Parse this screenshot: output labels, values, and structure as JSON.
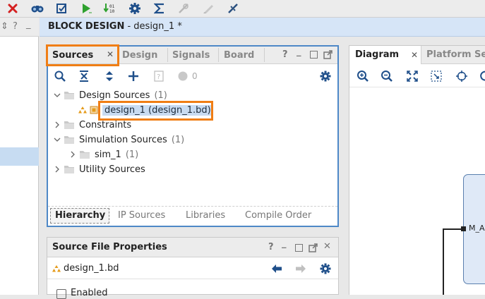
{
  "toolbar": {
    "buttons": [
      "close-icon",
      "binoculars-icon",
      "checkbox-icon",
      "run-icon",
      "run-step-icon",
      "gear-icon",
      "sigma-icon",
      "disabled-tool-icon",
      "disabled-edit-icon",
      "disconnect-icon"
    ]
  },
  "left_strip": {
    "glyphs": "⇕ ? _"
  },
  "block_design": {
    "title_bold": "BLOCK DESIGN",
    "title_rest": " - design_1 *"
  },
  "sources_panel": {
    "tabs": [
      "Sources",
      "Design",
      "Signals",
      "Board"
    ],
    "active_tab": "Sources",
    "close_glyph": "✕",
    "toolbar_count": "0",
    "tree": {
      "design_sources": {
        "label": "Design Sources",
        "count": "(1)"
      },
      "design_file": {
        "label": "design_1 (design_1.bd)"
      },
      "constraints": {
        "label": "Constraints"
      },
      "simulation_sources": {
        "label": "Simulation Sources",
        "count": "(1)"
      },
      "sim_1": {
        "label": "sim_1",
        "count": "(1)"
      },
      "utility_sources": {
        "label": "Utility Sources"
      }
    },
    "bottom_tabs": [
      "Hierarchy",
      "IP Sources",
      "Libraries",
      "Compile Order"
    ],
    "active_bottom_tab": "Hierarchy"
  },
  "source_file_properties": {
    "title": "Source File Properties",
    "file": "design_1.bd",
    "next_row": "Enabled"
  },
  "diagram_panel": {
    "tabs": [
      "Diagram",
      "Platform Setup"
    ],
    "block_port_label": "M_A"
  },
  "colors": {
    "highlight": "#f07e15",
    "panel_border": "#4e88c7",
    "header_bg": "#d6e5f7",
    "selection": "#c7dcf2"
  }
}
